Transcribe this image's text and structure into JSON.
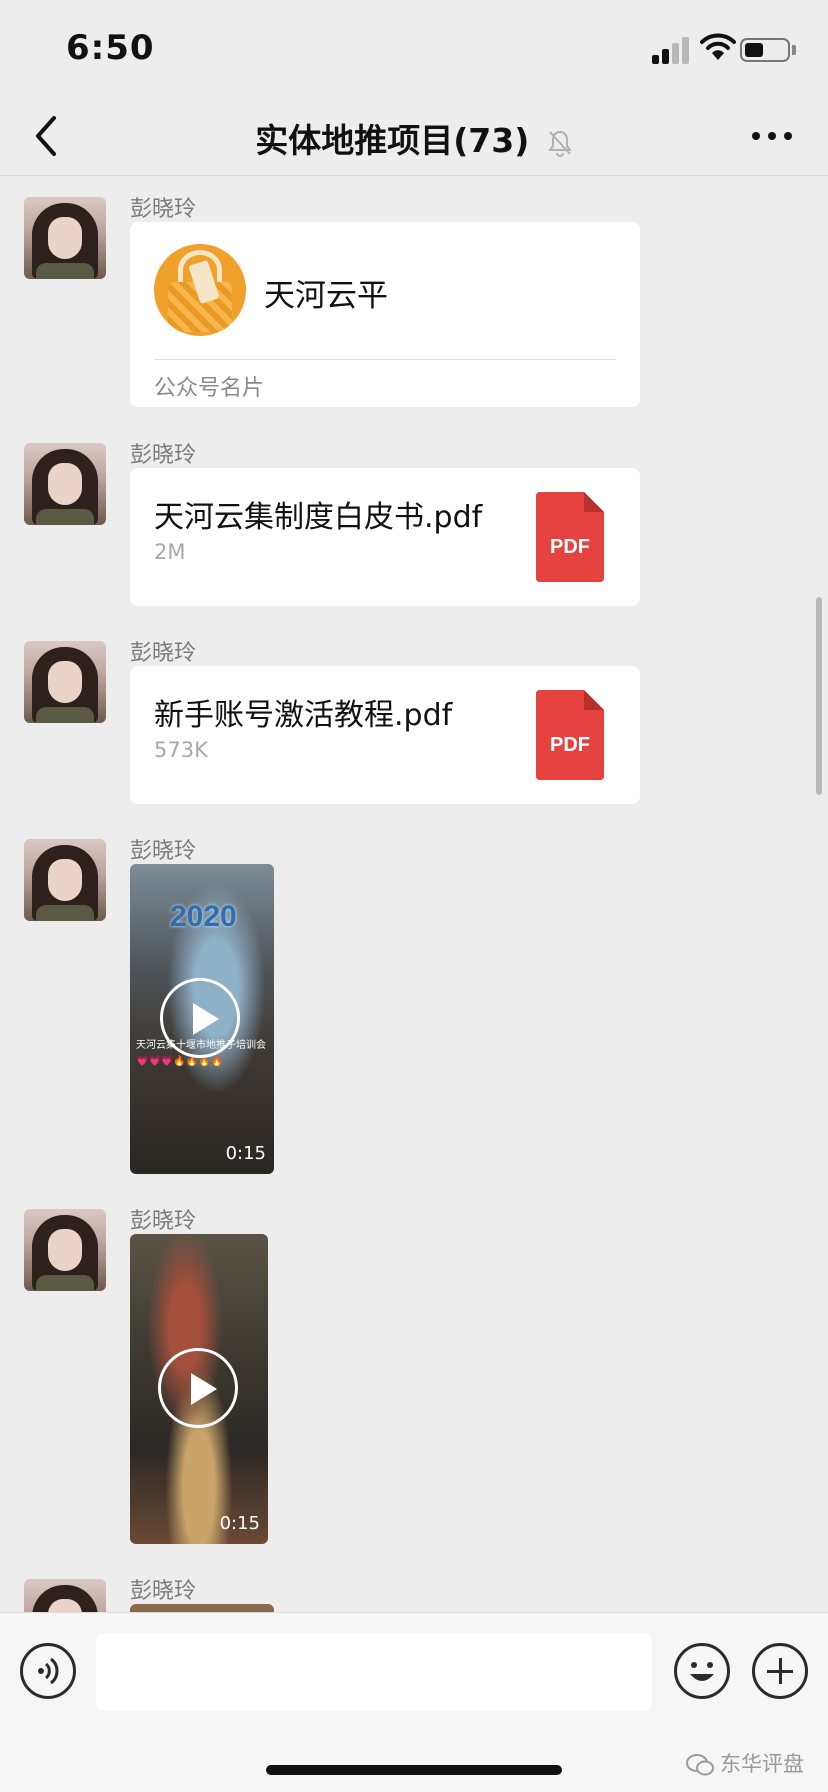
{
  "status_bar": {
    "time": "6:50"
  },
  "nav": {
    "title": "实体地推项目(73)"
  },
  "messages": [
    {
      "type": "card",
      "sender": "彭晓玲",
      "name": "天河云平",
      "card_type": "公众号名片"
    },
    {
      "type": "file",
      "sender": "彭晓玲",
      "file_name": "天河云集制度白皮书.pdf",
      "size": "2M",
      "icon_label": "PDF"
    },
    {
      "type": "file",
      "sender": "彭晓玲",
      "file_name": "新手账号激活教程.pdf",
      "size": "573K",
      "icon_label": "PDF"
    },
    {
      "type": "video",
      "sender": "彭晓玲",
      "overlay_year": "2020",
      "caption": "天河云集十堰市地推子培训会💗💗💗🔥🔥🔥🔥",
      "duration": "0:15"
    },
    {
      "type": "video",
      "sender": "彭晓玲",
      "duration": "0:15"
    },
    {
      "type": "partial",
      "sender": "彭晓玲"
    }
  ],
  "input_bar": {
    "placeholder": ""
  },
  "watermark": "东华评盘",
  "colors": {
    "background": "#ededed",
    "bubble": "#ffffff",
    "pdf_red": "#e64340"
  }
}
